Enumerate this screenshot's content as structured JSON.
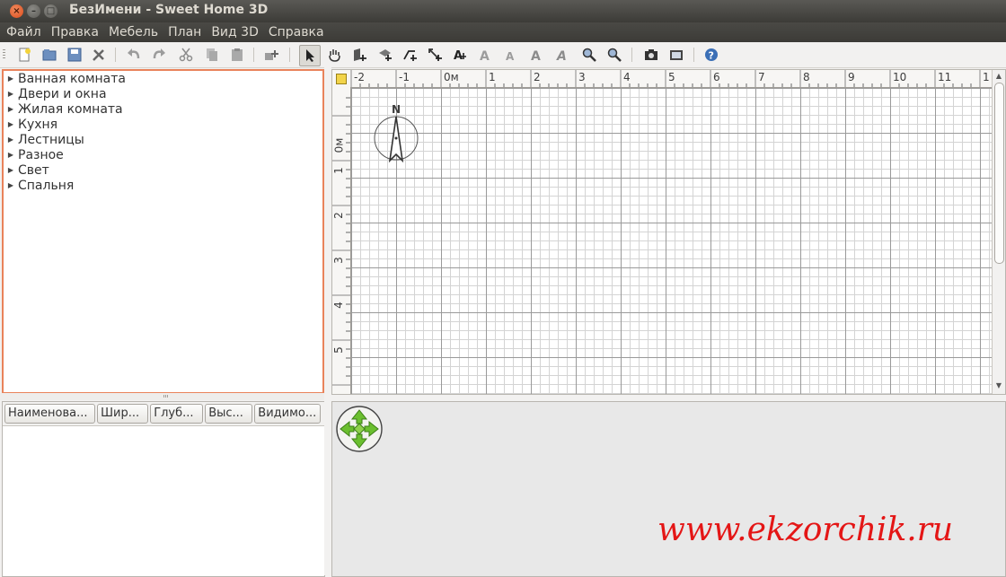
{
  "window": {
    "title": "БезИмени - Sweet Home 3D",
    "controls": [
      "×",
      "–",
      "□"
    ]
  },
  "menu": [
    {
      "label": "Файл"
    },
    {
      "label": "Правка"
    },
    {
      "label": "Мебель"
    },
    {
      "label": "План"
    },
    {
      "label": "Вид 3D"
    },
    {
      "label": "Справка"
    }
  ],
  "toolbar": {
    "icons": {
      "new": "new-file-icon",
      "open": "open-folder-icon",
      "save": "save-icon",
      "prefs": "tools-icon",
      "undo": "undo-icon",
      "redo": "redo-icon",
      "cut": "cut-icon",
      "copy": "copy-icon",
      "paste": "paste-icon",
      "add_furniture": "add-furniture-icon",
      "select": "select-arrow-icon",
      "pan": "pan-hand-icon",
      "create_walls": "create-walls-icon",
      "create_rooms": "create-rooms-icon",
      "create_polylines": "create-polylines-icon",
      "create_dimensions": "create-dimensions-icon",
      "add_text": "add-text-icon",
      "zoom_in": "zoom-in-icon",
      "zoom_out": "zoom-out-icon",
      "create_photo": "camera-icon",
      "create_video": "video-icon",
      "help": "help-icon"
    }
  },
  "catalog": {
    "categories": [
      "Ванная комната",
      "Двери и окна",
      "Жилая комната",
      "Кухня",
      "Лестницы",
      "Разное",
      "Свет",
      "Спальня"
    ]
  },
  "furniture_table": {
    "columns": [
      "Наименова...",
      "Шир...",
      "Глуб...",
      "Выс...",
      "Видимо..."
    ]
  },
  "plan": {
    "ruler_x": [
      "-2",
      "-1",
      "0м",
      "1",
      "2",
      "3",
      "4",
      "5",
      "6",
      "7",
      "8",
      "9",
      "10",
      "11",
      "1"
    ],
    "ruler_y": [
      "0м",
      "1",
      "2",
      "3",
      "4",
      "5"
    ],
    "compass_label": "N"
  },
  "watermark": "www.ekzorchik.ru",
  "colors": {
    "titlebar": "#3c3b37",
    "close_button": "#dc4c1c",
    "catalog_focus_border": "#e9835b",
    "watermark": "#e41616",
    "nav_arrows": "#6bbf2f"
  }
}
